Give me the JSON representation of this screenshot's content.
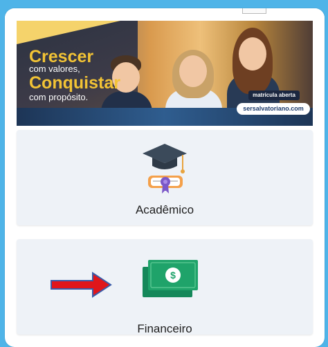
{
  "banner": {
    "line1": "Crescer",
    "line2": "com valores,",
    "line3": "Conquistar",
    "line4": "com propósito.",
    "badge": "matrícula aberta",
    "site": "sersalvatoriano.com"
  },
  "cards": {
    "academico": {
      "label": "Acadêmico",
      "icon": "graduation-cap-icon"
    },
    "financeiro": {
      "label": "Financeiro",
      "icon": "money-icon"
    }
  },
  "colors": {
    "background": "#4fb4e8",
    "card": "#eef2f7",
    "money_green": "#1fa36a",
    "arrow_red": "#e0161b",
    "arrow_border": "#3a5ba8",
    "cap_dark": "#3b4a5a",
    "diploma": "#f4a04a"
  }
}
